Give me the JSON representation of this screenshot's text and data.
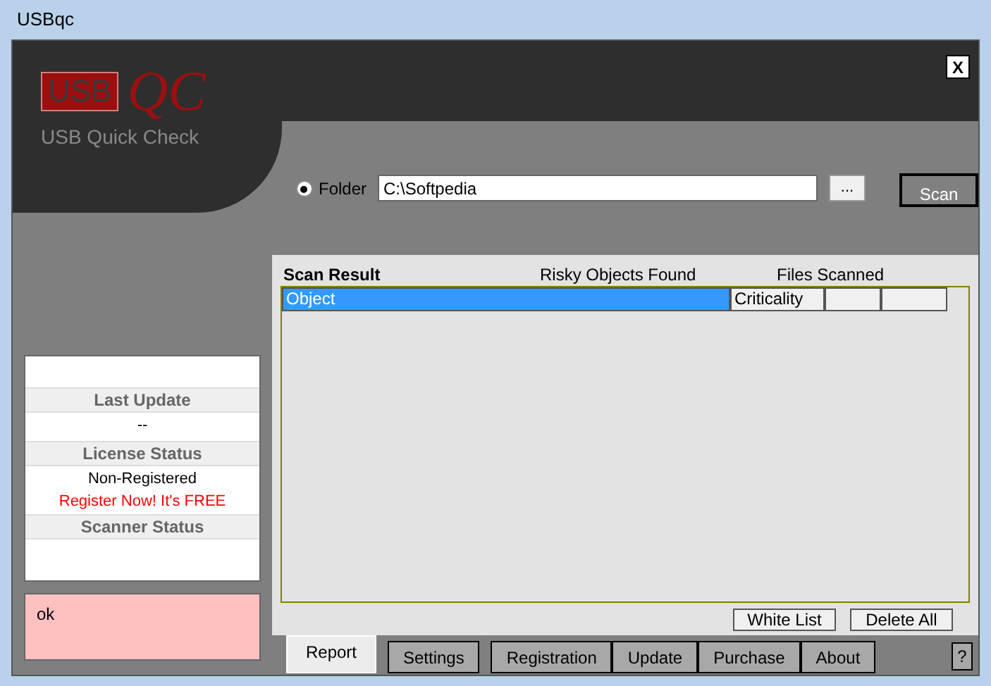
{
  "window": {
    "title": "USBqc",
    "close_label": "X"
  },
  "logo": {
    "mark": "USB",
    "script": "QC",
    "subtitle": "USB Quick Check"
  },
  "scan_source": {
    "radio_label": "Folder",
    "selected": true,
    "path": "C:\\Softpedia",
    "browse_label": "...",
    "scan_label": "Scan"
  },
  "status_panel": {
    "sections": [
      {
        "heading": "Last Update",
        "lines": [
          {
            "text": "--",
            "kind": "plain"
          }
        ]
      },
      {
        "heading": "License Status",
        "lines": [
          {
            "text": "Non-Registered",
            "kind": "plain"
          },
          {
            "text": "Register Now! It's FREE",
            "kind": "alert"
          }
        ]
      },
      {
        "heading": "Scanner Status"
      }
    ]
  },
  "message_box": {
    "text": "ok"
  },
  "results": {
    "title": "Scan Result",
    "labels": [
      "Risky Objects Found",
      "Files Scanned"
    ],
    "columns": [
      {
        "label": "Object",
        "selected": true
      },
      {
        "label": "Criticality",
        "selected": false
      },
      {
        "selected": false
      },
      {
        "selected": false
      }
    ],
    "buttons": [
      "White List",
      "Delete All"
    ]
  },
  "tabs": [
    {
      "label": "Report",
      "selected": true
    },
    {
      "label": "Settings",
      "selected": false
    },
    {
      "label": "Registration",
      "selected": false
    },
    {
      "label": "Update",
      "selected": false
    },
    {
      "label": "Purchase",
      "selected": false
    },
    {
      "label": "About",
      "selected": false
    }
  ],
  "help_label": "?"
}
